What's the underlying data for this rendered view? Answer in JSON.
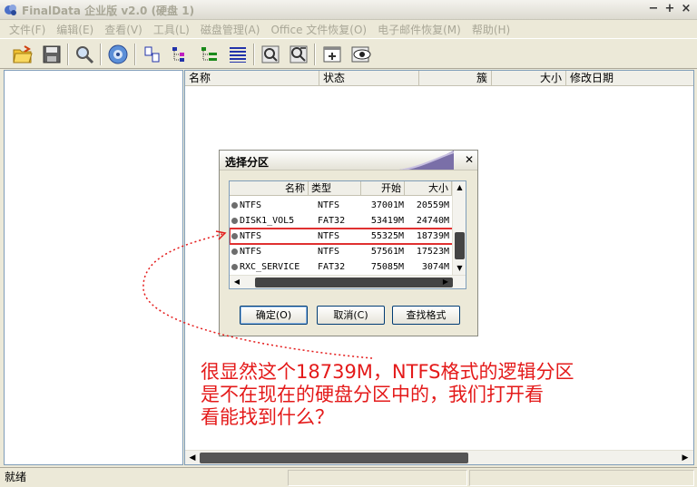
{
  "window": {
    "title": "FinalData 企业版 v2.0 (硬盘 1)",
    "controls": [
      "−",
      "+",
      "×"
    ]
  },
  "menu": [
    "文件(F)",
    "编辑(E)",
    "查看(V)",
    "工具(L)",
    "磁盘管理(A)",
    "Office 文件恢复(O)",
    "电子邮件恢复(M)",
    "帮助(H)"
  ],
  "toolbar_icons": [
    "open-folder-icon",
    "save-disk-icon",
    "search-magnifier-icon",
    "disk-settings-icon",
    "file-pages-icon",
    "tree-view-icon",
    "tree-detail-icon",
    "list-grid-icon",
    "find-icon",
    "find-detail-icon",
    "new-window-icon",
    "view-eye-icon"
  ],
  "file_list": {
    "columns": [
      "名称",
      "状态",
      "簇",
      "大小",
      "修改日期"
    ]
  },
  "statusbar": {
    "text": "就绪"
  },
  "dialog": {
    "title": "选择分区",
    "columns": [
      "名称",
      "类型",
      "开始",
      "大小"
    ],
    "partitions": [
      {
        "name": "NTFS",
        "type": "NTFS",
        "start": "37001M",
        "size": "20559M"
      },
      {
        "name": "DISK1_VOL5",
        "type": "FAT32",
        "start": "53419M",
        "size": "24740M"
      },
      {
        "name": "NTFS",
        "type": "NTFS",
        "start": "55325M",
        "size": "18739M"
      },
      {
        "name": "NTFS",
        "type": "NTFS",
        "start": "57561M",
        "size": "17523M"
      },
      {
        "name": "RXC_SERVICE",
        "type": "FAT32",
        "start": "75085M",
        "size": "3074M"
      }
    ],
    "highlighted_row": 2,
    "buttons": {
      "ok": "确定(O)",
      "cancel": "取消(C)",
      "find_format": "查找格式"
    }
  },
  "annotation": {
    "lines": [
      "很显然这个18739M，NTFS格式的逻辑分区",
      "是不在现在的硬盘分区中的，我们打开看",
      "看能找到什么？"
    ],
    "color": "#e41a1a"
  }
}
